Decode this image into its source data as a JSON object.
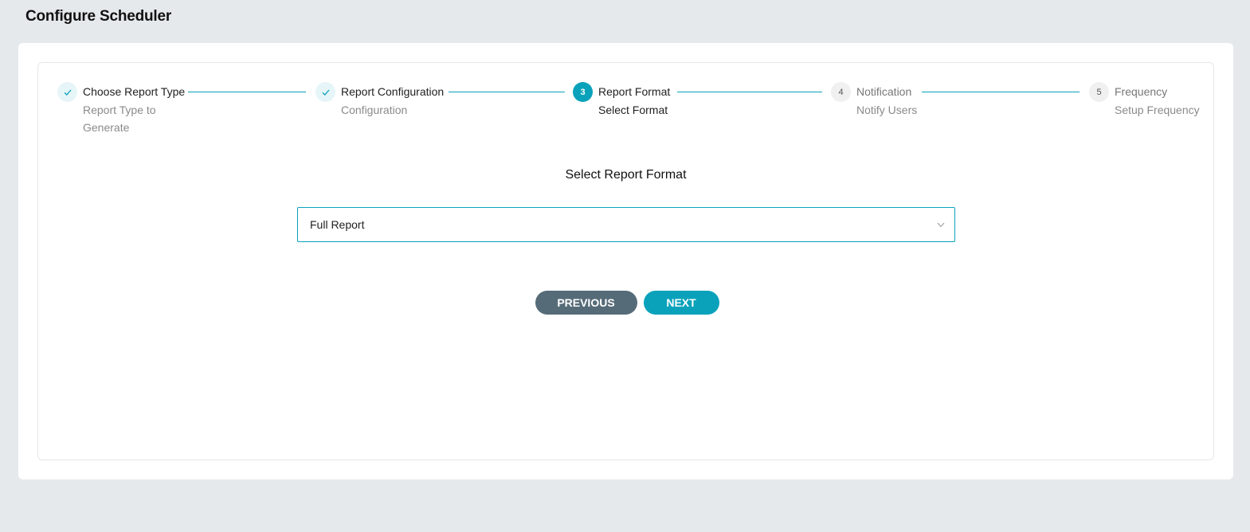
{
  "page": {
    "title": "Configure Scheduler"
  },
  "steps": [
    {
      "number": "1",
      "title": "Choose Report Type",
      "description": "Report Type to Generate",
      "state": "done"
    },
    {
      "number": "2",
      "title": "Report Configuration",
      "description": "Configuration",
      "state": "done"
    },
    {
      "number": "3",
      "title": "Report Format",
      "description": "Select Format",
      "state": "active"
    },
    {
      "number": "4",
      "title": "Notification",
      "description": "Notify Users",
      "state": "pending"
    },
    {
      "number": "5",
      "title": "Frequency",
      "description": "Setup Frequency",
      "state": "pending"
    }
  ],
  "form": {
    "section_title": "Select Report Format",
    "format_select": {
      "value": "Full Report"
    }
  },
  "buttons": {
    "previous": "PREVIOUS",
    "next": "NEXT"
  },
  "colors": {
    "accent": "#0aa2bb",
    "secondary_button": "#566b78",
    "background": "#e6e9ec"
  }
}
